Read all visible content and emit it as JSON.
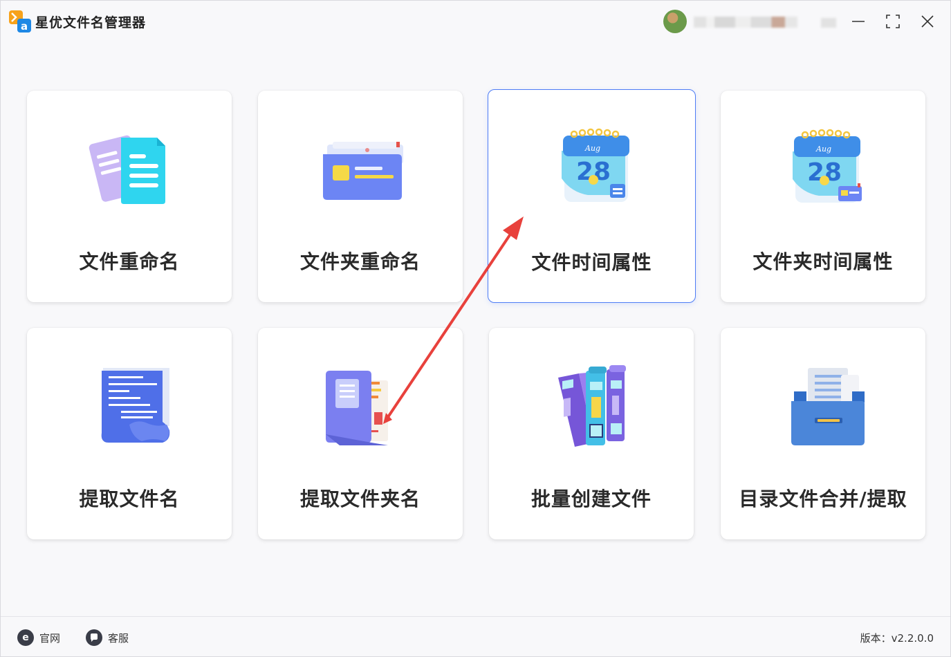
{
  "app": {
    "title": "星优文件名管理器",
    "logo_glyph": "a"
  },
  "window_controls": {
    "minimize": "minimize-icon",
    "maximize": "maximize-icon",
    "close": "close-icon"
  },
  "cards": [
    {
      "label": "文件重命名",
      "icon": "documents-icon"
    },
    {
      "label": "文件夹重命名",
      "icon": "folder-icon"
    },
    {
      "label": "文件时间属性",
      "icon": "calendar-icon"
    },
    {
      "label": "文件夹时间属性",
      "icon": "calendar-folder-icon"
    },
    {
      "label": "提取文件名",
      "icon": "scroll-list-icon"
    },
    {
      "label": "提取文件夹名",
      "icon": "folder-documents-icon"
    },
    {
      "label": "批量创建文件",
      "icon": "binders-icon"
    },
    {
      "label": "目录文件合并/提取",
      "icon": "file-drawer-icon"
    }
  ],
  "calendar_month": "Aug",
  "calendar_day": "28",
  "footer": {
    "website_label": "官网",
    "service_label": "客服",
    "version_text": "版本：v2.2.0.0"
  },
  "colors": {
    "accent": "#4d7cf5",
    "arrow": "#e8413c"
  }
}
